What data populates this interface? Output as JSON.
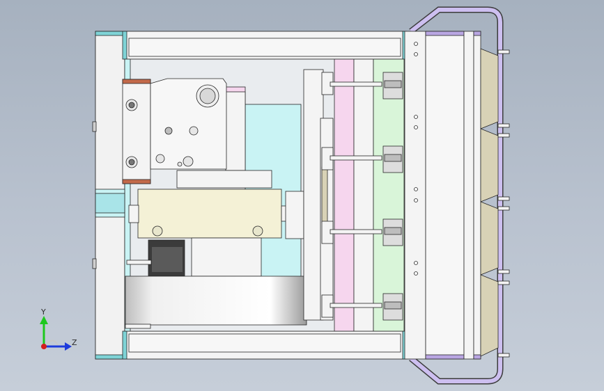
{
  "view": {
    "orientation_triad": {
      "y_label": "Y",
      "z_label": "Z",
      "colors": {
        "y": "#1ec81e",
        "z": "#1e3cdc",
        "x": "#d21e1e"
      }
    }
  },
  "colors": {
    "background_top": "#a6b1bf",
    "background_bottom": "#c6ced9",
    "part_white": "#f4f4f4",
    "part_cyan": "#c9f3f4",
    "part_pink": "#f6d6ee",
    "part_green": "#d9f5d9",
    "part_tan": "#d8d2b6",
    "part_purple": "#b9a6e2",
    "part_copper": "#c36a4a"
  }
}
